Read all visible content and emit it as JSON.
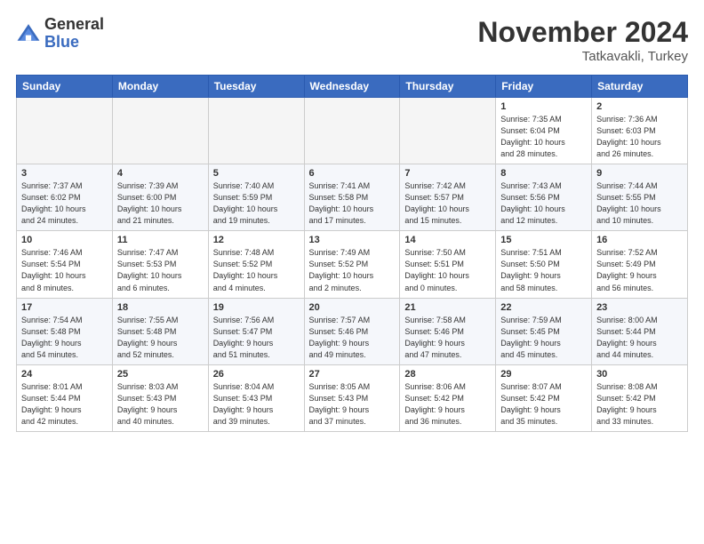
{
  "header": {
    "logo_general": "General",
    "logo_blue": "Blue",
    "month_year": "November 2024",
    "location": "Tatkavakli, Turkey"
  },
  "weekdays": [
    "Sunday",
    "Monday",
    "Tuesday",
    "Wednesday",
    "Thursday",
    "Friday",
    "Saturday"
  ],
  "weeks": [
    [
      {
        "day": "",
        "info": ""
      },
      {
        "day": "",
        "info": ""
      },
      {
        "day": "",
        "info": ""
      },
      {
        "day": "",
        "info": ""
      },
      {
        "day": "",
        "info": ""
      },
      {
        "day": "1",
        "info": "Sunrise: 7:35 AM\nSunset: 6:04 PM\nDaylight: 10 hours\nand 28 minutes."
      },
      {
        "day": "2",
        "info": "Sunrise: 7:36 AM\nSunset: 6:03 PM\nDaylight: 10 hours\nand 26 minutes."
      }
    ],
    [
      {
        "day": "3",
        "info": "Sunrise: 7:37 AM\nSunset: 6:02 PM\nDaylight: 10 hours\nand 24 minutes."
      },
      {
        "day": "4",
        "info": "Sunrise: 7:39 AM\nSunset: 6:00 PM\nDaylight: 10 hours\nand 21 minutes."
      },
      {
        "day": "5",
        "info": "Sunrise: 7:40 AM\nSunset: 5:59 PM\nDaylight: 10 hours\nand 19 minutes."
      },
      {
        "day": "6",
        "info": "Sunrise: 7:41 AM\nSunset: 5:58 PM\nDaylight: 10 hours\nand 17 minutes."
      },
      {
        "day": "7",
        "info": "Sunrise: 7:42 AM\nSunset: 5:57 PM\nDaylight: 10 hours\nand 15 minutes."
      },
      {
        "day": "8",
        "info": "Sunrise: 7:43 AM\nSunset: 5:56 PM\nDaylight: 10 hours\nand 12 minutes."
      },
      {
        "day": "9",
        "info": "Sunrise: 7:44 AM\nSunset: 5:55 PM\nDaylight: 10 hours\nand 10 minutes."
      }
    ],
    [
      {
        "day": "10",
        "info": "Sunrise: 7:46 AM\nSunset: 5:54 PM\nDaylight: 10 hours\nand 8 minutes."
      },
      {
        "day": "11",
        "info": "Sunrise: 7:47 AM\nSunset: 5:53 PM\nDaylight: 10 hours\nand 6 minutes."
      },
      {
        "day": "12",
        "info": "Sunrise: 7:48 AM\nSunset: 5:52 PM\nDaylight: 10 hours\nand 4 minutes."
      },
      {
        "day": "13",
        "info": "Sunrise: 7:49 AM\nSunset: 5:52 PM\nDaylight: 10 hours\nand 2 minutes."
      },
      {
        "day": "14",
        "info": "Sunrise: 7:50 AM\nSunset: 5:51 PM\nDaylight: 10 hours\nand 0 minutes."
      },
      {
        "day": "15",
        "info": "Sunrise: 7:51 AM\nSunset: 5:50 PM\nDaylight: 9 hours\nand 58 minutes."
      },
      {
        "day": "16",
        "info": "Sunrise: 7:52 AM\nSunset: 5:49 PM\nDaylight: 9 hours\nand 56 minutes."
      }
    ],
    [
      {
        "day": "17",
        "info": "Sunrise: 7:54 AM\nSunset: 5:48 PM\nDaylight: 9 hours\nand 54 minutes."
      },
      {
        "day": "18",
        "info": "Sunrise: 7:55 AM\nSunset: 5:48 PM\nDaylight: 9 hours\nand 52 minutes."
      },
      {
        "day": "19",
        "info": "Sunrise: 7:56 AM\nSunset: 5:47 PM\nDaylight: 9 hours\nand 51 minutes."
      },
      {
        "day": "20",
        "info": "Sunrise: 7:57 AM\nSunset: 5:46 PM\nDaylight: 9 hours\nand 49 minutes."
      },
      {
        "day": "21",
        "info": "Sunrise: 7:58 AM\nSunset: 5:46 PM\nDaylight: 9 hours\nand 47 minutes."
      },
      {
        "day": "22",
        "info": "Sunrise: 7:59 AM\nSunset: 5:45 PM\nDaylight: 9 hours\nand 45 minutes."
      },
      {
        "day": "23",
        "info": "Sunrise: 8:00 AM\nSunset: 5:44 PM\nDaylight: 9 hours\nand 44 minutes."
      }
    ],
    [
      {
        "day": "24",
        "info": "Sunrise: 8:01 AM\nSunset: 5:44 PM\nDaylight: 9 hours\nand 42 minutes."
      },
      {
        "day": "25",
        "info": "Sunrise: 8:03 AM\nSunset: 5:43 PM\nDaylight: 9 hours\nand 40 minutes."
      },
      {
        "day": "26",
        "info": "Sunrise: 8:04 AM\nSunset: 5:43 PM\nDaylight: 9 hours\nand 39 minutes."
      },
      {
        "day": "27",
        "info": "Sunrise: 8:05 AM\nSunset: 5:43 PM\nDaylight: 9 hours\nand 37 minutes."
      },
      {
        "day": "28",
        "info": "Sunrise: 8:06 AM\nSunset: 5:42 PM\nDaylight: 9 hours\nand 36 minutes."
      },
      {
        "day": "29",
        "info": "Sunrise: 8:07 AM\nSunset: 5:42 PM\nDaylight: 9 hours\nand 35 minutes."
      },
      {
        "day": "30",
        "info": "Sunrise: 8:08 AM\nSunset: 5:42 PM\nDaylight: 9 hours\nand 33 minutes."
      }
    ]
  ]
}
